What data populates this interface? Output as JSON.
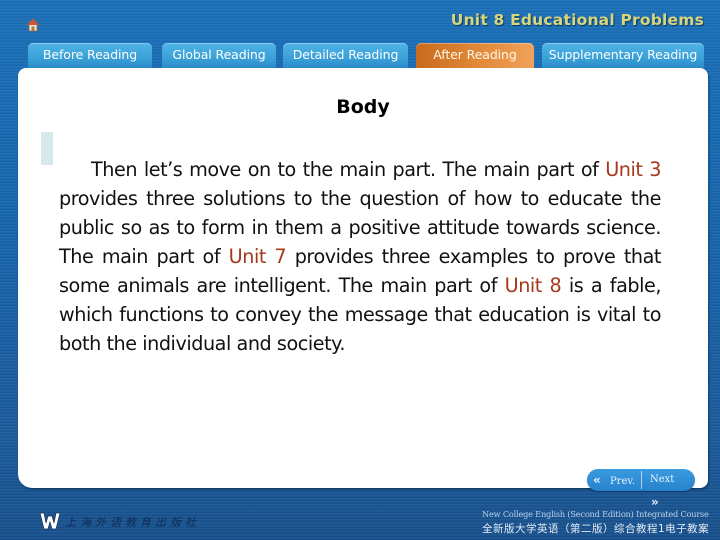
{
  "header": {
    "home_icon": "home-icon",
    "unit_title": "Unit 8 Educational Problems"
  },
  "tabs": [
    {
      "label": "Before Reading",
      "active": false
    },
    {
      "label": "Global Reading",
      "active": false
    },
    {
      "label": "Detailed Reading",
      "active": false
    },
    {
      "label": "After Reading",
      "active": true
    },
    {
      "label": "Supplementary Reading",
      "active": false
    }
  ],
  "colors": {
    "active_tab": "#e28a3b",
    "inactive_tab": "#3aa1d8",
    "highlight_text": "#a4391b",
    "title_text": "#d9d57a"
  },
  "panel": {
    "heading": "Body",
    "paragraph": {
      "s1": "Then let’s move on to the main part. The main part of ",
      "h1": "Unit 3",
      "s2": " provides three solutions to the question of how to educate the public so as to form in them a positive attitude towards science. The main part of ",
      "h2": "Unit 7",
      "s3": " provides three examples to prove that some animals are intelligent. The main part of ",
      "h3": "Unit 8",
      "s4": " is a fable, which functions to convey the message that education is vital to both the individual and society."
    }
  },
  "nav": {
    "prev_label": "Prev.",
    "next_label": "Next",
    "prev_icon": "«",
    "next_icon": "»"
  },
  "footer": {
    "logo_letter": "W",
    "publisher": "上海外语教育出版社",
    "course_en": "New College English (Second Edition) Integrated Course",
    "course_cn": "全新版大学英语（第二版）综合教程1电子教案"
  }
}
